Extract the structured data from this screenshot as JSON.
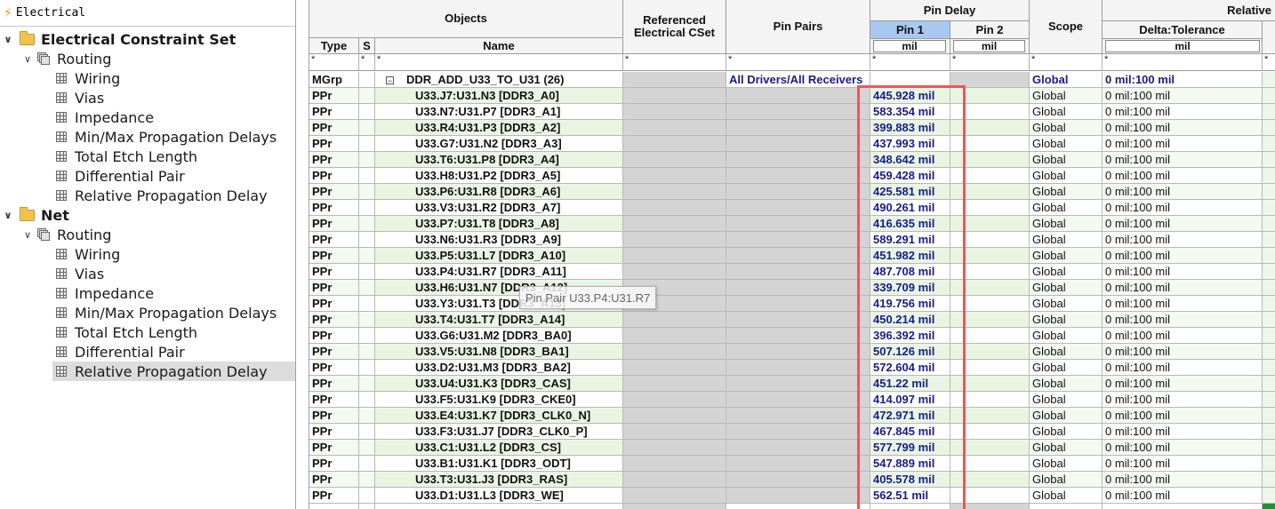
{
  "tree": {
    "header": "Electrical",
    "nodes": [
      {
        "label": "Electrical Constraint Set",
        "level": 0,
        "kind": "folder",
        "bold": true
      },
      {
        "label": "Routing",
        "level": 1,
        "kind": "stack"
      },
      {
        "label": "Wiring",
        "level": 2,
        "kind": "grid"
      },
      {
        "label": "Vias",
        "level": 2,
        "kind": "grid"
      },
      {
        "label": "Impedance",
        "level": 2,
        "kind": "grid"
      },
      {
        "label": "Min/Max Propagation Delays",
        "level": 2,
        "kind": "grid"
      },
      {
        "label": "Total Etch Length",
        "level": 2,
        "kind": "grid"
      },
      {
        "label": "Differential Pair",
        "level": 2,
        "kind": "grid"
      },
      {
        "label": "Relative Propagation Delay",
        "level": 2,
        "kind": "grid"
      },
      {
        "label": "Net",
        "level": 0,
        "kind": "folder",
        "bold": true
      },
      {
        "label": "Routing",
        "level": 1,
        "kind": "stack"
      },
      {
        "label": "Wiring",
        "level": 2,
        "kind": "grid"
      },
      {
        "label": "Vias",
        "level": 2,
        "kind": "grid"
      },
      {
        "label": "Impedance",
        "level": 2,
        "kind": "grid"
      },
      {
        "label": "Min/Max Propagation Delays",
        "level": 2,
        "kind": "grid"
      },
      {
        "label": "Total Etch Length",
        "level": 2,
        "kind": "grid"
      },
      {
        "label": "Differential Pair",
        "level": 2,
        "kind": "grid"
      },
      {
        "label": "Relative Propagation Delay",
        "level": 2,
        "kind": "grid",
        "selected": true
      }
    ]
  },
  "grid": {
    "headers": {
      "objects": "Objects",
      "type": "Type",
      "s": "S",
      "name": "Name",
      "ref_cset": "Referenced Electrical CSet",
      "pin_pairs": "Pin Pairs",
      "pin_delay": "Pin Delay",
      "pin1": "Pin 1",
      "pin2": "Pin 2",
      "pin1_unit": "mil",
      "pin2_unit": "mil",
      "scope": "Scope",
      "relative": "Relative",
      "delta_tol": "Delta:Tolerance",
      "delta_unit": "mil"
    },
    "filter": "*",
    "group_row": {
      "type": "MGrp",
      "expander": "−",
      "name": "DDR_ADD_U33_TO_U31 (26)",
      "pin_pairs": "All Drivers/All Receivers",
      "scope": "Global",
      "delta": "0 mil:100 mil"
    },
    "rows": [
      {
        "type": "PPr",
        "name": "U33.J7:U31.N3 [DDR3_A0]",
        "pin1": "445.928 mil",
        "scope": "Global",
        "delta": "0 mil:100 mil"
      },
      {
        "type": "PPr",
        "name": "U33.N7:U31.P7 [DDR3_A1]",
        "pin1": "583.354 mil",
        "scope": "Global",
        "delta": "0 mil:100 mil"
      },
      {
        "type": "PPr",
        "name": "U33.R4:U31.P3 [DDR3_A2]",
        "pin1": "399.883 mil",
        "scope": "Global",
        "delta": "0 mil:100 mil"
      },
      {
        "type": "PPr",
        "name": "U33.G7:U31.N2 [DDR3_A3]",
        "pin1": "437.993 mil",
        "scope": "Global",
        "delta": "0 mil:100 mil"
      },
      {
        "type": "PPr",
        "name": "U33.T6:U31.P8 [DDR3_A4]",
        "pin1": "348.642 mil",
        "scope": "Global",
        "delta": "0 mil:100 mil"
      },
      {
        "type": "PPr",
        "name": "U33.H8:U31.P2 [DDR3_A5]",
        "pin1": "459.428 mil",
        "scope": "Global",
        "delta": "0 mil:100 mil"
      },
      {
        "type": "PPr",
        "name": "U33.P6:U31.R8 [DDR3_A6]",
        "pin1": "425.581 mil",
        "scope": "Global",
        "delta": "0 mil:100 mil"
      },
      {
        "type": "PPr",
        "name": "U33.V3:U31.R2 [DDR3_A7]",
        "pin1": "490.261 mil",
        "scope": "Global",
        "delta": "0 mil:100 mil"
      },
      {
        "type": "PPr",
        "name": "U33.P7:U31.T8 [DDR3_A8]",
        "pin1": "416.635 mil",
        "scope": "Global",
        "delta": "0 mil:100 mil"
      },
      {
        "type": "PPr",
        "name": "U33.N6:U31.R3 [DDR3_A9]",
        "pin1": "589.291 mil",
        "scope": "Global",
        "delta": "0 mil:100 mil"
      },
      {
        "type": "PPr",
        "name": "U33.P5:U31.L7 [DDR3_A10]",
        "pin1": "451.982 mil",
        "scope": "Global",
        "delta": "0 mil:100 mil"
      },
      {
        "type": "PPr",
        "name": "U33.P4:U31.R7 [DDR3_A11]",
        "pin1": "487.708 mil",
        "scope": "Global",
        "delta": "0 mil:100 mil"
      },
      {
        "type": "PPr",
        "name": "U33.H6:U31.N7 [DDR3_A12]",
        "pin1": "339.709 mil",
        "scope": "Global",
        "delta": "0 mil:100 mil"
      },
      {
        "type": "PPr",
        "name": "U33.Y3:U31.T3 [DDR3_A13]",
        "pin1": "419.756 mil",
        "scope": "Global",
        "delta": "0 mil:100 mil"
      },
      {
        "type": "PPr",
        "name": "U33.T4:U31.T7 [DDR3_A14]",
        "pin1": "450.214 mil",
        "scope": "Global",
        "delta": "0 mil:100 mil"
      },
      {
        "type": "PPr",
        "name": "U33.G6:U31.M2 [DDR3_BA0]",
        "pin1": "396.392 mil",
        "scope": "Global",
        "delta": "0 mil:100 mil"
      },
      {
        "type": "PPr",
        "name": "U33.V5:U31.N8 [DDR3_BA1]",
        "pin1": "507.126 mil",
        "scope": "Global",
        "delta": "0 mil:100 mil"
      },
      {
        "type": "PPr",
        "name": "U33.D2:U31.M3 [DDR3_BA2]",
        "pin1": "572.604 mil",
        "scope": "Global",
        "delta": "0 mil:100 mil"
      },
      {
        "type": "PPr",
        "name": "U33.U4:U31.K3 [DDR3_CAS]",
        "pin1": "451.22 mil",
        "scope": "Global",
        "delta": "0 mil:100 mil"
      },
      {
        "type": "PPr",
        "name": "U33.F5:U31.K9 [DDR3_CKE0]",
        "pin1": "414.097 mil",
        "scope": "Global",
        "delta": "0 mil:100 mil"
      },
      {
        "type": "PPr",
        "name": "U33.E4:U31.K7 [DDR3_CLK0_N]",
        "pin1": "472.971 mil",
        "scope": "Global",
        "delta": "0 mil:100 mil"
      },
      {
        "type": "PPr",
        "name": "U33.F3:U31.J7 [DDR3_CLK0_P]",
        "pin1": "467.845 mil",
        "scope": "Global",
        "delta": "0 mil:100 mil"
      },
      {
        "type": "PPr",
        "name": "U33.C1:U31.L2 [DDR3_CS]",
        "pin1": "577.799 mil",
        "scope": "Global",
        "delta": "0 mil:100 mil"
      },
      {
        "type": "PPr",
        "name": "U33.B1:U31.K1 [DDR3_ODT]",
        "pin1": "547.889 mil",
        "scope": "Global",
        "delta": "0 mil:100 mil"
      },
      {
        "type": "PPr",
        "name": "U33.T3:U31.J3 [DDR3_RAS]",
        "pin1": "405.578 mil",
        "scope": "Global",
        "delta": "0 mil:100 mil"
      },
      {
        "type": "PPr",
        "name": "U33.D1:U31.L3 [DDR3_WE]",
        "pin1": "562.51 mil",
        "scope": "Global",
        "delta": "0 mil:100 mil"
      }
    ],
    "tooltip": "Pin Pair U33.P4:U31.R7"
  },
  "colors": {
    "pin1_header": "#a8c8f0",
    "value_text": "#1a1a8c",
    "row_alt": "#e9f5e3",
    "highlight_box": "#e8585a"
  }
}
